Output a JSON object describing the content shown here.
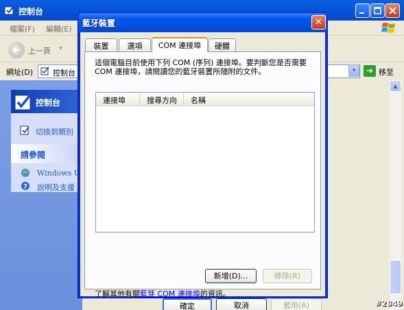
{
  "bg_window": {
    "title": "控制台",
    "menu": {
      "file": "檔案(F)",
      "edit": "編輯(E)"
    },
    "toolbar": {
      "back_label": "上一頁",
      "back_dropdown": "▾"
    },
    "addressbar": {
      "label": "網址(D)",
      "value": "控制台",
      "dropdown": "▾",
      "go_icon": "➔",
      "go_label": "移至"
    },
    "left_pane": {
      "control_panel_title": "控制台",
      "switch_view_label": "切換到類別",
      "see_also_title": "請參閱",
      "windows_update_label": "Windows Up",
      "help_label": "說明及支援"
    },
    "scrollbar": {
      "up_arrow": "▲"
    },
    "watermark": "#2849"
  },
  "dialog": {
    "title": "藍牙裝置",
    "close_glyph": "✕",
    "tabs": [
      {
        "label": "裝置"
      },
      {
        "label": "選項"
      },
      {
        "label": "COM 連接埠"
      },
      {
        "label": "硬體"
      }
    ],
    "active_tab": "COM 連接埠",
    "intro_text": "這個電腦目前使用下列 COM (序列) 連接埠。要判斷您是否需要 COM 連接埠，請閱讀您的藍牙裝置所隨附的文件。",
    "list": {
      "columns": [
        "連接埠",
        "搜尋方向",
        "名稱"
      ],
      "rows": []
    },
    "add_button": "新增(D)...",
    "remove_button": "移除(R)",
    "learn_prefix": "了解其他有關",
    "learn_link": "藍芽 COM 連接埠",
    "learn_suffix": "的資訊。",
    "ok_button": "確定",
    "cancel_button": "取消",
    "apply_button": "套用(A)"
  },
  "colors": {
    "title_blue": "#0058ee",
    "dialog_face": "#ece9d8",
    "link_blue": "#0000ff",
    "task_link_blue": "#215dc6",
    "close_red": "#c7381a"
  }
}
